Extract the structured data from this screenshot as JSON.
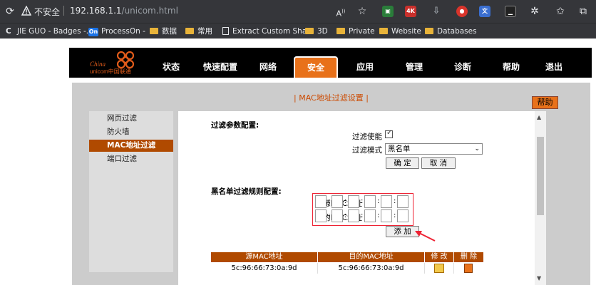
{
  "browser": {
    "security_label": "不安全",
    "url_host": "192.168.1.1",
    "url_path": "/unicom.html",
    "extensions": [
      {
        "name": "sheets-ext",
        "color": "#2a7d3a",
        "text": ""
      },
      {
        "name": "4k-ext",
        "color": "#c9302c",
        "text": "4K"
      },
      {
        "name": "download-ext",
        "color": "#5a5a5a",
        "text": ""
      },
      {
        "name": "record-ext",
        "color": "#d9342b",
        "text": ""
      },
      {
        "name": "translate-ext",
        "color": "#3a6ecf",
        "text": ""
      },
      {
        "name": "terminal-ext",
        "color": "#222",
        "text": ""
      }
    ]
  },
  "bookmarks": [
    {
      "label": "JIE GUO - Badges -...",
      "icon": "c-icon"
    },
    {
      "label": "ProcessOn -",
      "icon": "on-icon"
    },
    {
      "label": "数据",
      "icon": "folder-icon"
    },
    {
      "label": "常用",
      "icon": "folder-icon"
    },
    {
      "label": "Extract Custom Sha...",
      "icon": "page-icon"
    },
    {
      "label": "3D",
      "icon": "folder-icon"
    },
    {
      "label": "Private",
      "icon": "folder-icon"
    },
    {
      "label": "Website",
      "icon": "folder-icon"
    },
    {
      "label": "Databases",
      "icon": "folder-icon"
    }
  ],
  "router": {
    "logo_text_1": "China",
    "logo_text_2": "unicom中国联通",
    "nav": [
      "状态",
      "快速配置",
      "网络",
      "安全",
      "应用",
      "管理",
      "诊断",
      "帮助",
      "退出"
    ],
    "active_nav": "安全",
    "page_title": "| MAC地址过滤设置 |",
    "help_label": "帮助",
    "sidebar": [
      "网页过滤",
      "防火墙",
      "MAC地址过滤",
      "端口过滤"
    ],
    "active_sidebar": "MAC地址过滤",
    "filter_params_title": "过滤参数配置:",
    "enable_label": "过滤使能",
    "enable_checked": true,
    "mode_label": "过滤模式",
    "mode_value": "黑名单",
    "confirm_label": "确 定",
    "cancel_label": "取 消",
    "blacklist_title": "黑名单过滤规则配置:",
    "src_mac_label": "源MAC地址",
    "dst_mac_label": "目的MAC地址",
    "add_label": "添 加",
    "table": {
      "headers": [
        "源MAC地址",
        "目的MAC地址",
        "修 改",
        "删 除"
      ],
      "rows": [
        [
          "5c:96:66:73:0a:9d",
          "5c:96:66:73:0a:9d"
        ]
      ]
    }
  }
}
